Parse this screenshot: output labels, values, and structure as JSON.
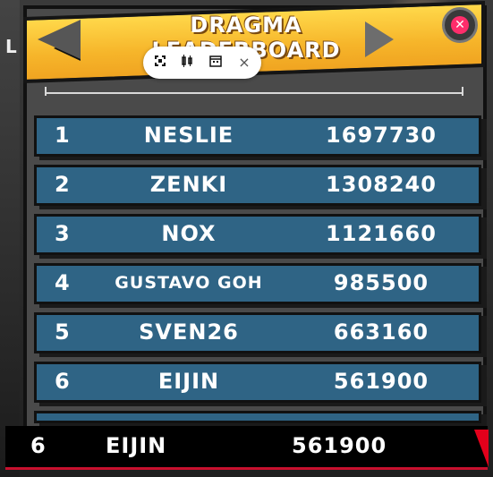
{
  "window": {
    "left_strip_text": "L"
  },
  "header": {
    "title": "DRAGMA\nLEADERBOARD",
    "prev_icon": "triangle-left",
    "next_icon": "triangle-right",
    "close_icon": "close-x"
  },
  "toolbar": {
    "icons": [
      "fit-icon",
      "candles-icon",
      "calendar-icon",
      "close-icon"
    ],
    "close_glyph": "×"
  },
  "leaderboard": {
    "rows": [
      {
        "rank": "1",
        "name": "NESLIE",
        "score": "1697730"
      },
      {
        "rank": "2",
        "name": "ZENKI",
        "score": "1308240"
      },
      {
        "rank": "3",
        "name": "NOX",
        "score": "1121660"
      },
      {
        "rank": "4",
        "name": "GUSTAVO GOH",
        "score": "985500"
      },
      {
        "rank": "5",
        "name": "SVEN26",
        "score": "663160"
      },
      {
        "rank": "6",
        "name": "EIJIN",
        "score": "561900"
      }
    ]
  },
  "player": {
    "rank": "6",
    "name": "EIJIN",
    "score": "561900"
  },
  "colors": {
    "banner": "#f6b52a",
    "row": "#2f6485",
    "close_accent": "#ff2d6b",
    "bottom_accent": "#e3001b"
  }
}
